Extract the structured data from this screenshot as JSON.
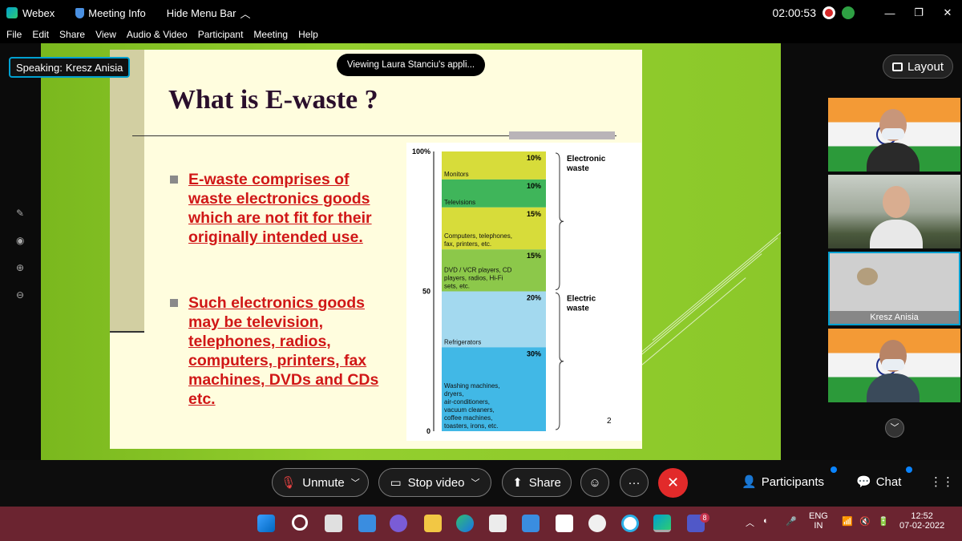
{
  "titlebar": {
    "app_name": "Webex",
    "meeting_info": "Meeting Info",
    "hide_menu_bar": "Hide Menu Bar",
    "timer": "02:00:53"
  },
  "menu": [
    "File",
    "Edit",
    "Share",
    "View",
    "Audio & Video",
    "Participant",
    "Meeting",
    "Help"
  ],
  "share": {
    "speaking_label": "Speaking:",
    "speaking_name": "Kresz Anisia",
    "viewing_text": "Viewing Laura Stanciu's appli...",
    "layout_label": "Layout"
  },
  "slide": {
    "title": "What is E-waste ?",
    "bullets": [
      "E-waste comprises of waste electronics goods which are not fit for their originally intended use.",
      "Such electronics goods may be television, telephones, radios, computers, printers, fax machines, DVDs and CDs etc."
    ],
    "page_number": "2"
  },
  "chart_data": {
    "type": "bar",
    "orientation": "stacked",
    "y_tick_labels": [
      "100%",
      "50",
      "0"
    ],
    "ylim": [
      0,
      100
    ],
    "segments": [
      {
        "label": "Monitors",
        "value": 10,
        "value_label": "10%",
        "color": "#d7dc3a"
      },
      {
        "label": "Televisions",
        "value": 10,
        "value_label": "10%",
        "color": "#3fb55a"
      },
      {
        "label": "Computers, telephones, fax, printers, etc.",
        "value": 15,
        "value_label": "15%",
        "color": "#d7dc3a"
      },
      {
        "label": "DVD / VCR players, CD players, radios, Hi-Fi sets, etc.",
        "value": 15,
        "value_label": "15%",
        "color": "#8cc84a"
      },
      {
        "label": "Refrigerators",
        "value": 20,
        "value_label": "20%",
        "color": "#a3d9ef"
      },
      {
        "label": "Washing machines, dryers, air-conditioners, vacuum cleaners, coffee machines, toasters, irons, etc.",
        "value": 30,
        "value_label": "30%",
        "color": "#41b8e6"
      }
    ],
    "groups": [
      {
        "label": "Electronic waste",
        "from": 50,
        "to": 100
      },
      {
        "label": "Electric waste",
        "from": 0,
        "to": 50
      }
    ]
  },
  "participants": [
    {
      "name": ""
    },
    {
      "name": ""
    },
    {
      "name": "Kresz Anisia"
    },
    {
      "name": ""
    }
  ],
  "controls": {
    "unmute": "Unmute",
    "stop_video": "Stop video",
    "share": "Share",
    "more": "···",
    "participants": "Participants",
    "chat": "Chat"
  },
  "taskbar": {
    "lang_top": "ENG",
    "lang_bottom": "IN",
    "time": "12:52",
    "date": "07-02-2022",
    "teams_badge": "8"
  }
}
